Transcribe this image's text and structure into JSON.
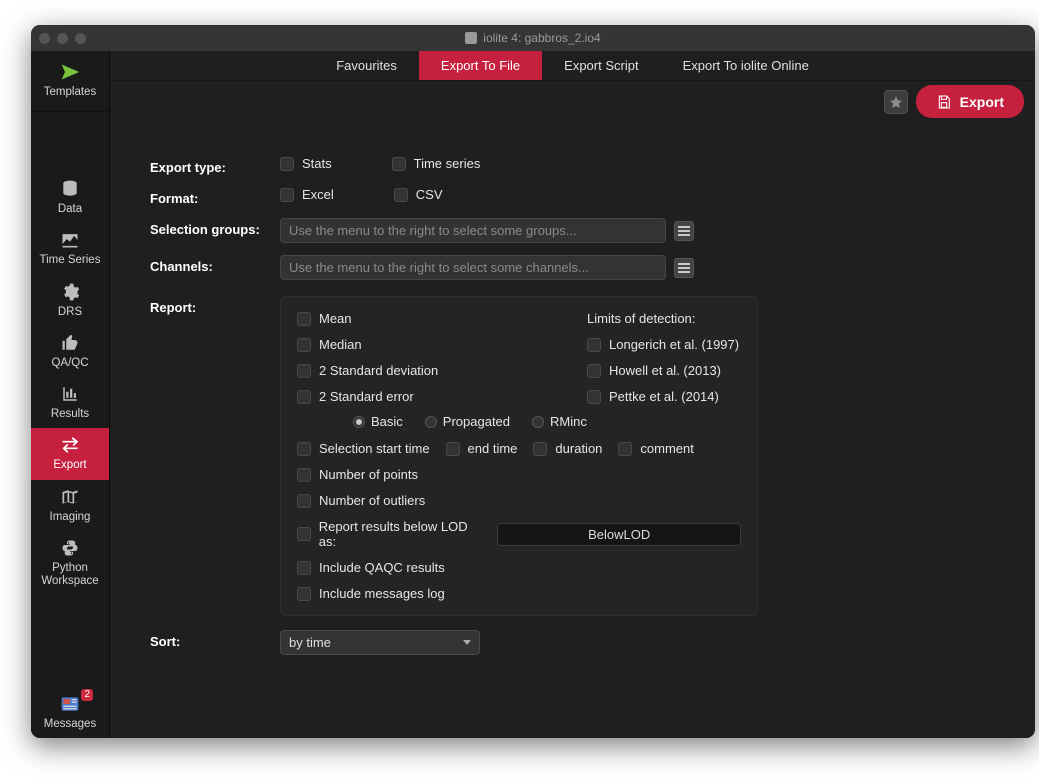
{
  "window": {
    "title": "iolite 4: gabbros_2.io4"
  },
  "sidebar": {
    "top": {
      "label": "Templates"
    },
    "items": [
      {
        "label": "Data"
      },
      {
        "label": "Time Series"
      },
      {
        "label": "DRS"
      },
      {
        "label": "QA/QC"
      },
      {
        "label": "Results"
      },
      {
        "label": "Export"
      },
      {
        "label": "Imaging"
      },
      {
        "label": "Python Workspace"
      }
    ],
    "messages": {
      "label": "Messages",
      "badge": "2"
    }
  },
  "tabs": [
    {
      "label": "Favourites"
    },
    {
      "label": "Export To File"
    },
    {
      "label": "Export Script"
    },
    {
      "label": "Export To iolite Online"
    }
  ],
  "actions": {
    "export_label": "Export"
  },
  "form": {
    "export_type_label": "Export type:",
    "stats": "Stats",
    "timeseries": "Time series",
    "format_label": "Format:",
    "excel": "Excel",
    "csv": "CSV",
    "selection_groups_label": "Selection groups:",
    "selection_groups_placeholder": "Use the menu to the right to select some groups...",
    "channels_label": "Channels:",
    "channels_placeholder": "Use the menu to the right to select some channels...",
    "report_label": "Report:",
    "sort_label": "Sort:",
    "sort_value": "by time"
  },
  "report": {
    "mean": "Mean",
    "median": "Median",
    "sd2": "2 Standard deviation",
    "se2": "2 Standard error",
    "lod_title": "Limits of detection:",
    "longerich": "Longerich et al. (1997)",
    "howell": "Howell et al. (2013)",
    "pettke": "Pettke et al. (2014)",
    "basic": "Basic",
    "propagated": "Propagated",
    "rminc": "RMinc",
    "sel_start": "Selection start time",
    "end_time": "end time",
    "duration": "duration",
    "comment": "comment",
    "npoints": "Number of points",
    "noutliers": "Number of outliers",
    "below_lod_label": "Report results below LOD as:",
    "below_lod_value": "BelowLOD",
    "include_qaqc": "Include QAQC results",
    "include_log": "Include messages log"
  }
}
